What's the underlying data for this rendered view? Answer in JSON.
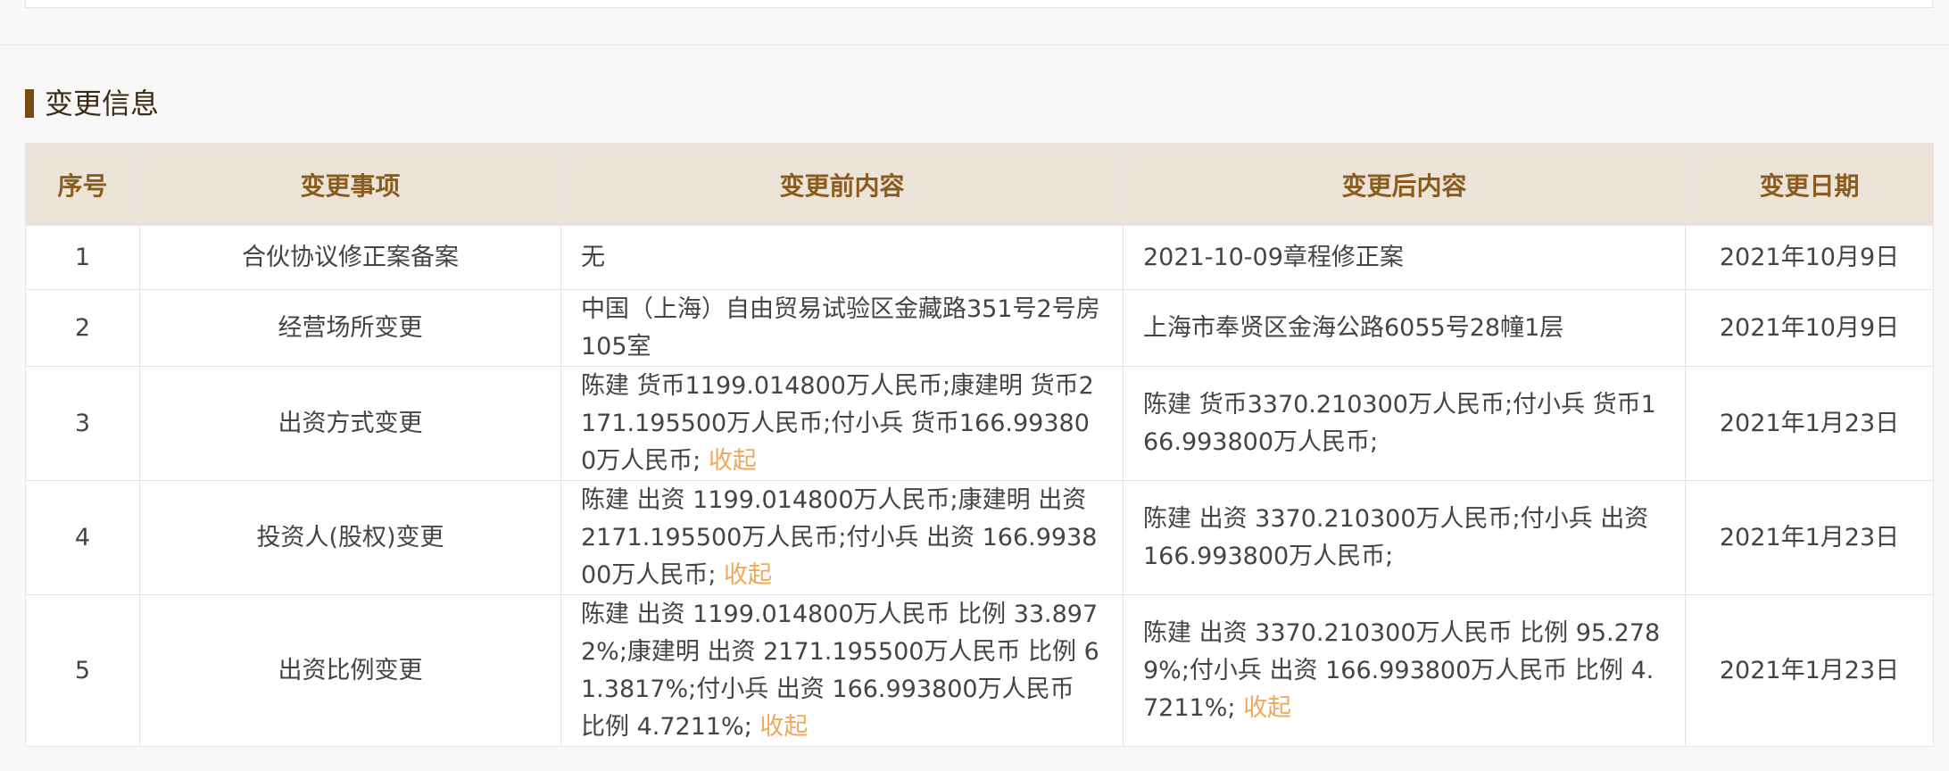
{
  "colors": {
    "title_bar": "#7a4a12",
    "title_text": "#3d2a12",
    "header_bg": "#ece4d8",
    "header_text": "#8a5d1e",
    "body_text": "#444444",
    "link": "#f0a95a",
    "page_bg": "#f8f8f8"
  },
  "section": {
    "title": "变更信息"
  },
  "table": {
    "headers": [
      "序号",
      "变更事项",
      "变更前内容",
      "变更后内容",
      "变更日期"
    ],
    "rows": [
      {
        "index": "1",
        "item": "合伙协议修正案备案",
        "before": "无",
        "after": "2021-10-09章程修正案",
        "date": "2021年10月9日"
      },
      {
        "index": "2",
        "item": "经营场所变更",
        "before": "中国（上海）自由贸易试验区金藏路351号2号房105室",
        "after": "上海市奉贤区金海公路6055号28幢1层",
        "date": "2021年10月9日"
      },
      {
        "index": "3",
        "item": "出资方式变更",
        "before": "陈建 货币1199.014800万人民币;康建明 货币2171.195500万人民币;付小兵 货币166.993800万人民币; ",
        "before_link": "收起",
        "after": "陈建 货币3370.210300万人民币;付小兵 货币166.993800万人民币;",
        "date": "2021年1月23日"
      },
      {
        "index": "4",
        "item": "投资人(股权)变更",
        "before": "陈建 出资 1199.014800万人民币;康建明 出资 2171.195500万人民币;付小兵 出资 166.993800万人民币; ",
        "before_link": "收起",
        "after": "陈建 出资 3370.210300万人民币;付小兵 出资 166.993800万人民币;",
        "date": "2021年1月23日"
      },
      {
        "index": "5",
        "item": "出资比例变更",
        "before": "陈建 出资 1199.014800万人民币 比例 33.8972%;康建明 出资 2171.195500万人民币 比例 61.3817%;付小兵 出资 166.993800万人民币 比例 4.7211%; ",
        "before_link": "收起",
        "after": "陈建 出资 3370.210300万人民币 比例 95.2789%;付小兵 出资 166.993800万人民币 比例 4.7211%; ",
        "after_link": "收起",
        "date": "2021年1月23日"
      }
    ]
  }
}
